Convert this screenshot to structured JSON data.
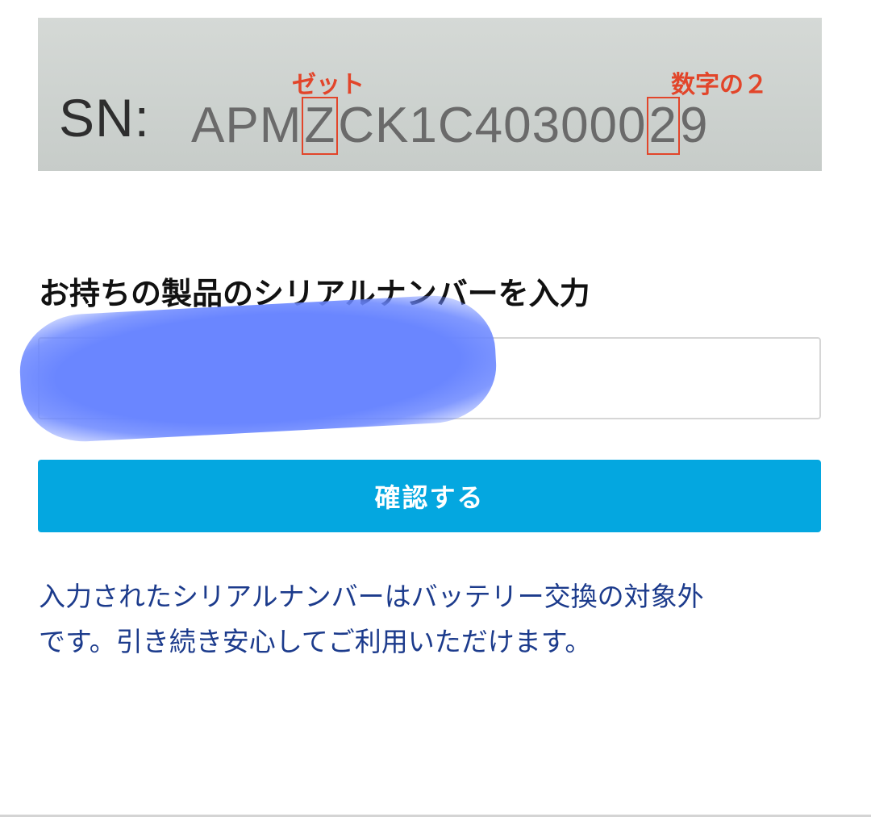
{
  "example_photo": {
    "sn_label": "SN:",
    "serial_parts": [
      "APM",
      "Z",
      "CK1C403000",
      "2",
      "9"
    ],
    "annotation_z": "ゼット",
    "annotation_2": "数字の２",
    "annotation_color": "#e2452a"
  },
  "form": {
    "heading": "お持ちの製品のシリアルナンバーを入力",
    "serial_input_value": "",
    "confirm_label": "確認する",
    "accent_color": "#04a7e0"
  },
  "result": {
    "line1": "入力されたシリアルナンバーはバッテリー交換の対象外",
    "line2": "です。引き続き安心してご利用いただけます。",
    "color": "#1c3b8c"
  }
}
